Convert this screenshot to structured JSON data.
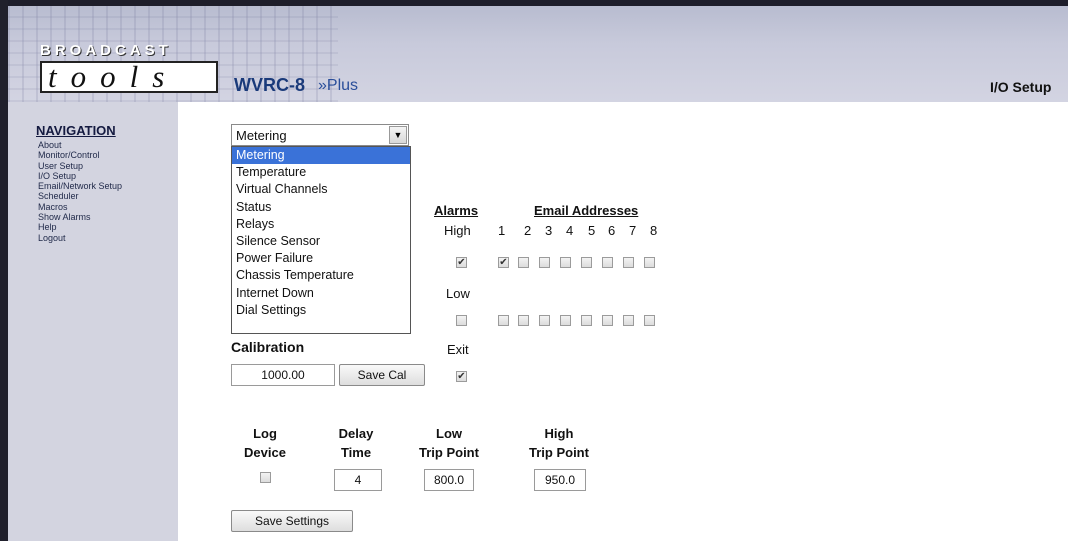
{
  "header": {
    "logo_top": "BROADCAST",
    "logo_bottom": "tools",
    "product_name": "WVRC-8",
    "product_sub": "»Plus",
    "page_section": "I/O Setup"
  },
  "navigation": {
    "title": "NAVIGATION",
    "items": [
      "About",
      "Monitor/Control",
      "User Setup",
      "I/O Setup",
      "Email/Network Setup",
      "Scheduler",
      "Macros",
      "Show Alarms",
      "Help",
      "Logout"
    ]
  },
  "metering_select": {
    "value": "Metering",
    "options": [
      "Metering",
      "Temperature",
      "Virtual Channels",
      "Status",
      "Relays",
      "Silence Sensor",
      "Power Failure",
      "Chassis Temperature",
      "Internet Down",
      "Dial Settings"
    ],
    "selected_index": 0
  },
  "alarms": {
    "title": "Alarms",
    "high_label": "High",
    "low_label": "Low",
    "exit_label": "Exit",
    "high_checked": true,
    "low_checked": false,
    "exit_checked": true
  },
  "email": {
    "title": "Email Addresses",
    "numbers": [
      "1",
      "2",
      "3",
      "4",
      "5",
      "6",
      "7",
      "8"
    ],
    "high_checked": [
      true,
      false,
      false,
      false,
      false,
      false,
      false,
      false
    ],
    "low_checked": [
      false,
      false,
      false,
      false,
      false,
      false,
      false,
      false
    ]
  },
  "calibration": {
    "label": "Calibration",
    "value": "1000.00",
    "button": "Save Cal"
  },
  "settings": {
    "log_device_line1": "Log",
    "log_device_line2": "Device",
    "delay_line1": "Delay",
    "delay_line2": "Time",
    "low_line1": "Low",
    "low_line2": "Trip Point",
    "high_line1": "High",
    "high_line2": "Trip Point",
    "log_device_checked": false,
    "delay_value": "4",
    "low_value": "800.0",
    "high_value": "950.0",
    "save_button": "Save Settings"
  },
  "colors": {
    "header_bg": "#c8cadb",
    "sidebar_bg": "#d3d4e0",
    "selected_option": "#3a72d8",
    "product_blue": "#1a3a7a"
  }
}
